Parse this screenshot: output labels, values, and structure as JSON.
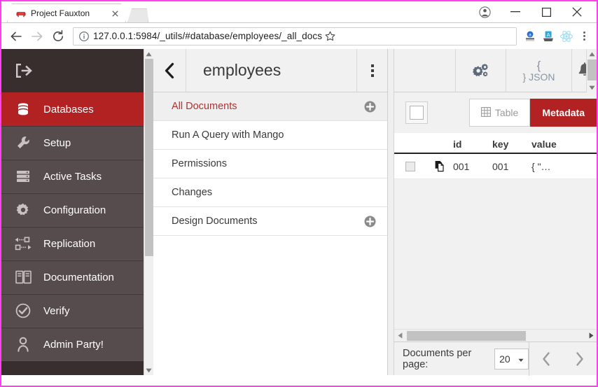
{
  "browser": {
    "tab": {
      "title": "Project Fauxton",
      "favicon_icon": "couch-favicon",
      "close_icon": "close-icon"
    },
    "new_tab_icon": "new-tab-icon",
    "window_controls": {
      "profile_icon": "profile-avatar-icon",
      "minimize_icon": "minimize-icon",
      "maximize_icon": "maximize-icon",
      "close_icon": "window-close-icon"
    },
    "nav": {
      "back_icon": "back-arrow-icon",
      "forward_icon": "forward-arrow-icon",
      "reload_icon": "reload-icon"
    },
    "omnibox": {
      "info_icon": "page-info-icon",
      "url_host": "127.0.0.1",
      "url_rest": ":5984/_utils/#database/employees/_all_docs",
      "url_full": "127.0.0.1:5984/_utils/#database/employees/_all_docs",
      "star_icon": "bookmark-star-icon"
    },
    "extensions": [
      "extension-a-icon",
      "extension-b-icon",
      "react-devtools-icon"
    ],
    "menu_icon": "chrome-menu-icon"
  },
  "sidebar": {
    "logo_icon": "fauxton-logo-icon",
    "items": [
      {
        "label": "Databases",
        "icon": "database-icon",
        "active": true
      },
      {
        "label": "Setup",
        "icon": "wrench-icon",
        "active": false
      },
      {
        "label": "Active Tasks",
        "icon": "tasks-icon",
        "active": false
      },
      {
        "label": "Configuration",
        "icon": "gear-icon",
        "active": false
      },
      {
        "label": "Replication",
        "icon": "replication-icon",
        "active": false
      },
      {
        "label": "Documentation",
        "icon": "book-icon",
        "active": false
      },
      {
        "label": "Verify",
        "icon": "check-circle-icon",
        "active": false
      },
      {
        "label": "Admin Party!",
        "icon": "user-icon",
        "active": false
      }
    ],
    "scrollbar": {
      "up_icon": "scroll-up-icon",
      "down_icon": "scroll-down-icon"
    }
  },
  "database_panel": {
    "back_icon": "chevron-left-icon",
    "title": "employees",
    "kebab_icon": "kebab-menu-icon",
    "items": [
      {
        "label": "All Documents",
        "selected": true,
        "has_add": true,
        "add_icon": "plus-circle-icon"
      },
      {
        "label": "Run A Query with Mango",
        "selected": false,
        "has_add": false,
        "add_icon": ""
      },
      {
        "label": "Permissions",
        "selected": false,
        "has_add": false,
        "add_icon": ""
      },
      {
        "label": "Changes",
        "selected": false,
        "has_add": false,
        "add_icon": ""
      },
      {
        "label": "Design Documents",
        "selected": true,
        "has_add": true,
        "add_icon": "plus-circle-icon"
      }
    ]
  },
  "docs_panel": {
    "header_icons": {
      "gear_icon": "gears-icon",
      "json_open": "{",
      "json_close": "} JSON",
      "bell_icon": "bell-icon"
    },
    "select_all_checkbox": "select-all-checkbox",
    "view_toggle": [
      {
        "label": "Table",
        "icon": "grid-icon",
        "active": false
      },
      {
        "label": "Metadata",
        "icon": "",
        "active": true
      }
    ],
    "columns": [
      "id",
      "key",
      "value"
    ],
    "rows": [
      {
        "checkbox": "row-checkbox",
        "doc_icon": "document-icon",
        "id": "001",
        "key": "001",
        "value": "{ \"…"
      }
    ],
    "h_scrollbar": {
      "left_icon": "scroll-left-icon",
      "right_icon": "scroll-right-icon"
    },
    "footer": {
      "per_page_label": "Documents per page:",
      "per_page_value": "20",
      "dropdown_icon": "chevron-down-icon",
      "prev_icon": "prev-page-icon",
      "next_icon": "next-page-icon"
    }
  },
  "colors": {
    "accent_red": "#b22222",
    "sidebar_bg": "#574c4d",
    "sidebar_dark": "#382e2e",
    "panel_bg": "#f1f1f1"
  }
}
